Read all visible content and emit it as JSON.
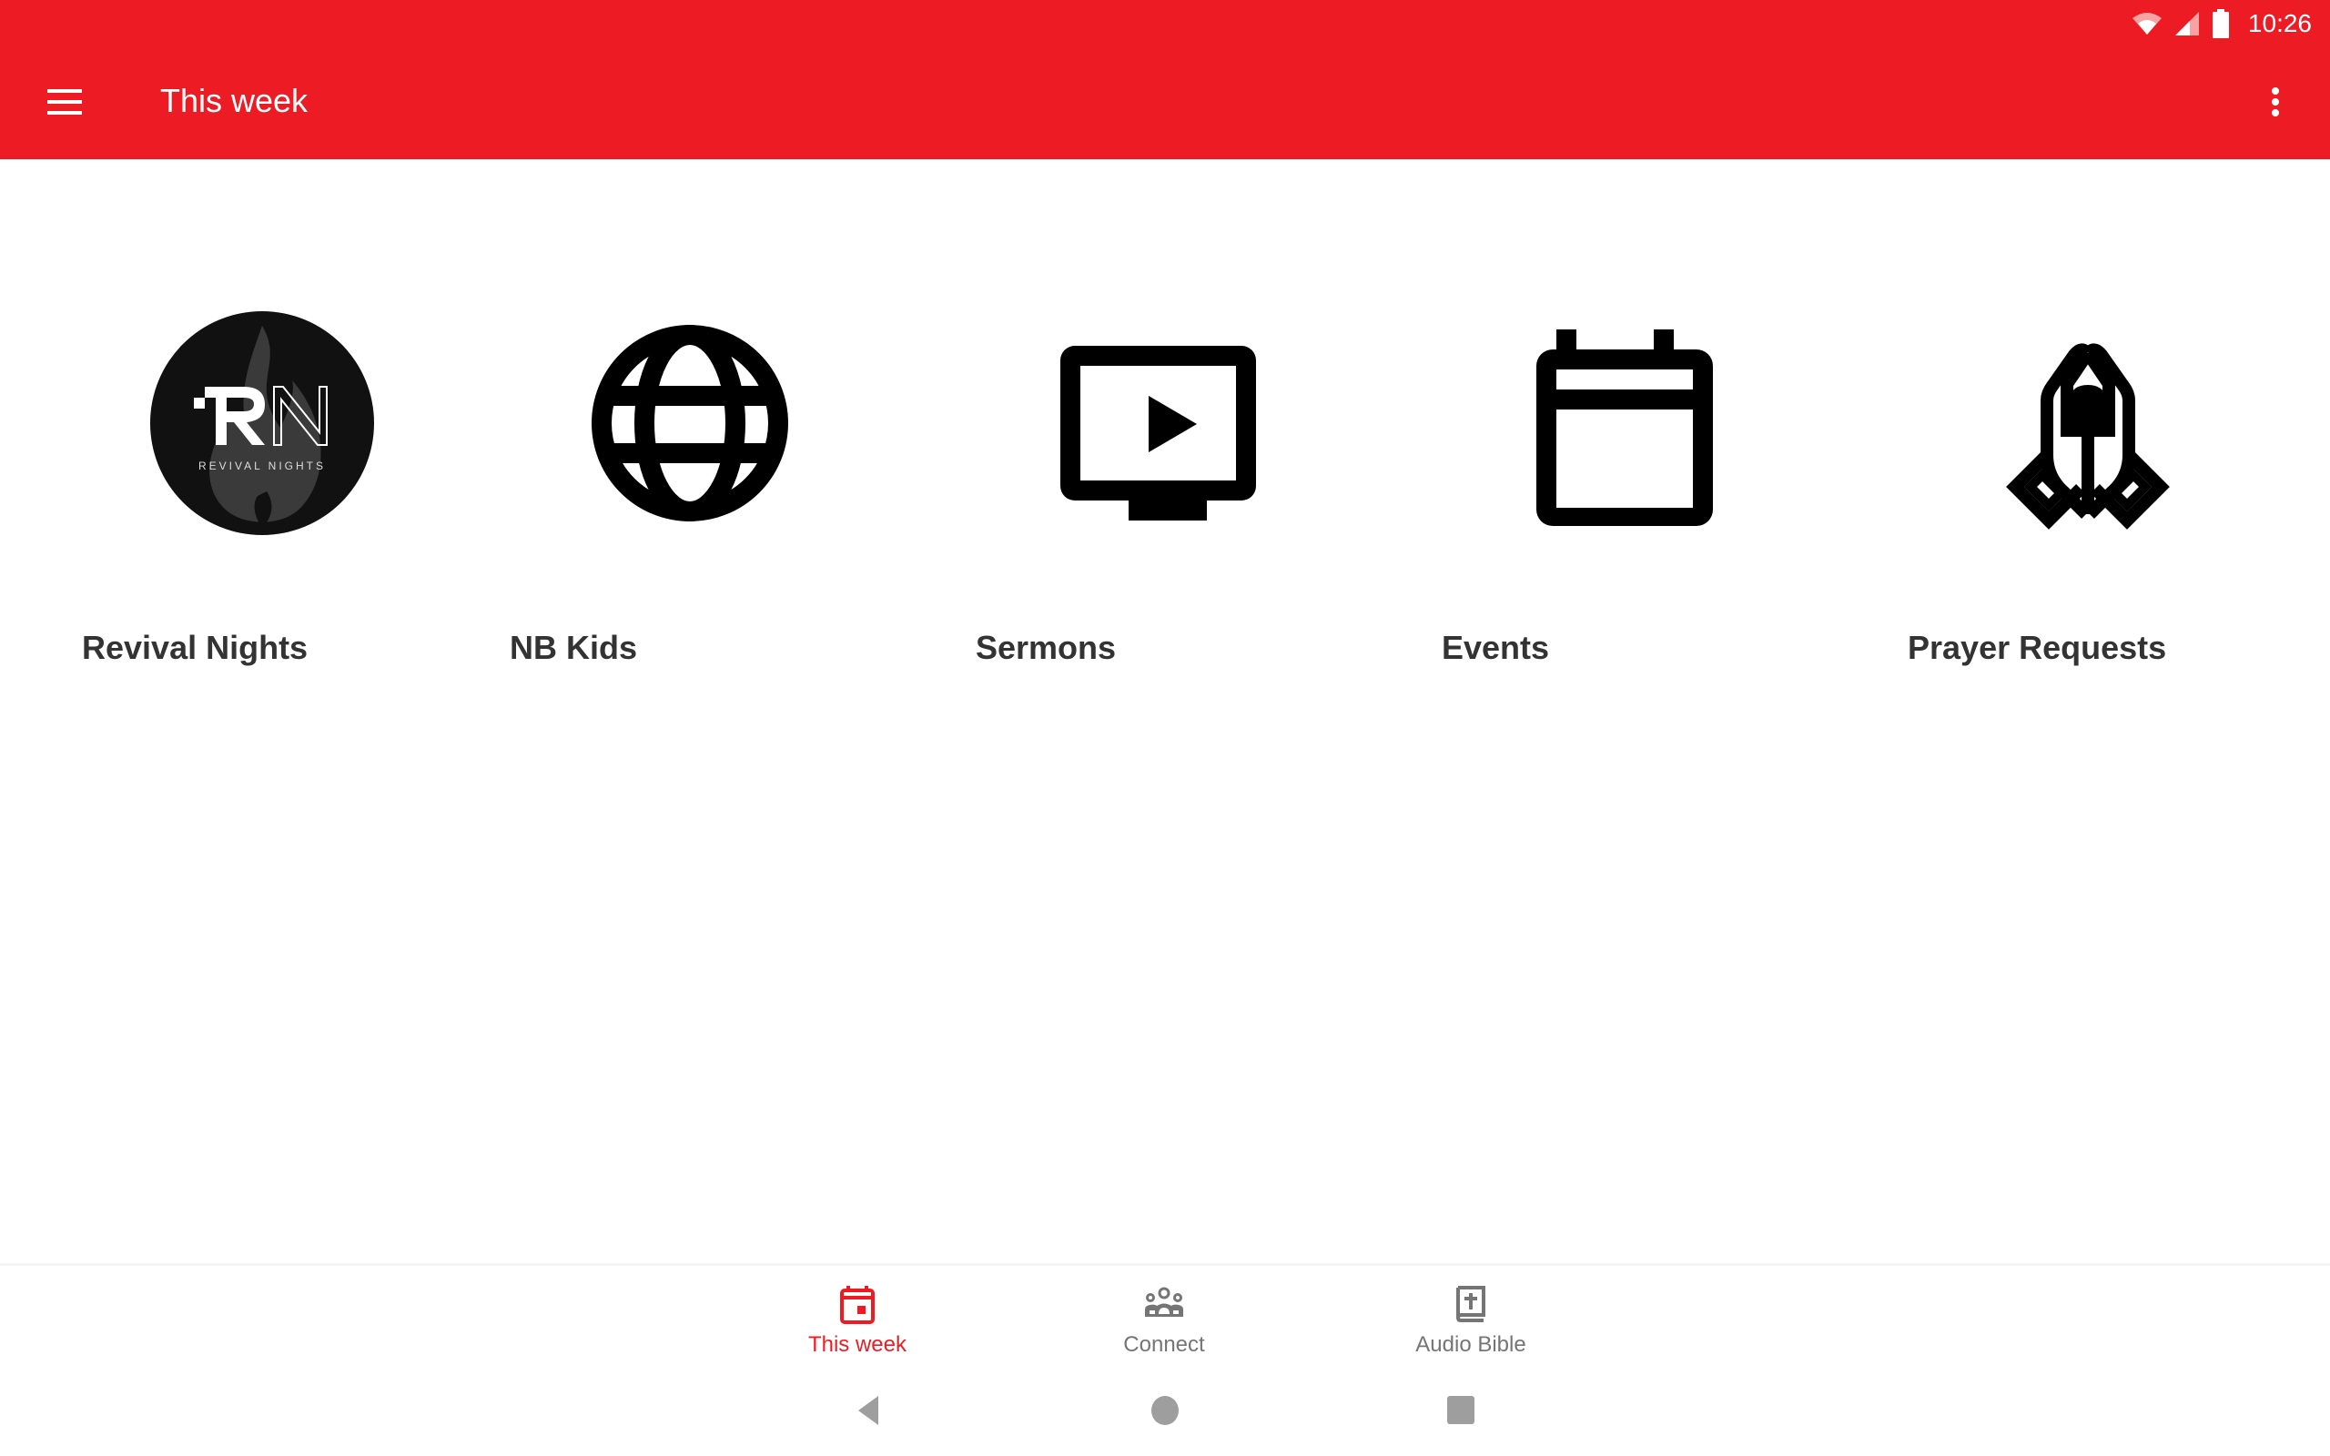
{
  "status_bar": {
    "time": "10:26",
    "icons": [
      "wifi-icon",
      "cell-signal-icon",
      "battery-icon"
    ]
  },
  "toolbar": {
    "menu_icon": "hamburger-menu-icon",
    "title": "This week",
    "overflow_icon": "more-vert-icon"
  },
  "tiles": [
    {
      "label": "Revival Nights",
      "icon": "revival-nights-logo",
      "logo_text": "REVIVAL NIGHTS",
      "logo_letters": "RN"
    },
    {
      "label": "NB Kids",
      "icon": "globe-icon"
    },
    {
      "label": "Sermons",
      "icon": "tv-play-icon"
    },
    {
      "label": "Events",
      "icon": "calendar-icon"
    },
    {
      "label": "Prayer Requests",
      "icon": "praying-hands-icon"
    }
  ],
  "bottom_nav": {
    "items": [
      {
        "label": "This week",
        "icon": "calendar-today-icon",
        "active": true
      },
      {
        "label": "Connect",
        "icon": "group-icon",
        "active": false
      },
      {
        "label": "Audio Bible",
        "icon": "bible-icon",
        "active": false
      }
    ]
  },
  "system_nav": [
    "back-icon",
    "home-icon",
    "recents-icon"
  ],
  "colors": {
    "primary": "#ED1C24",
    "label_text": "#333333",
    "nav_inactive": "#757575",
    "system_nav": "#9E9E9E"
  }
}
